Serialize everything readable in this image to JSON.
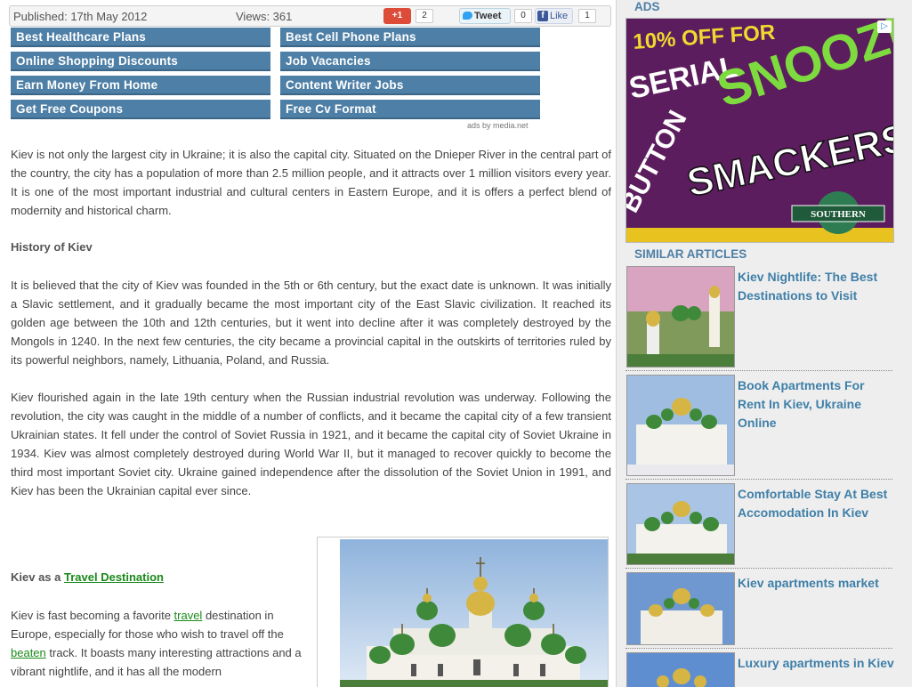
{
  "meta": {
    "published": "Published: 17th May 2012",
    "views": "Views: 361",
    "gplus_label": "+1",
    "gplus_count": "2",
    "tweet_label": "Tweet",
    "tweet_count": "0",
    "like_label": "Like",
    "like_count": "1"
  },
  "ad_links": [
    "Best Healthcare Plans",
    "Best Cell Phone Plans",
    "Online Shopping Discounts",
    "Job Vacancies",
    "Earn Money From Home",
    "Content Writer Jobs",
    "Get Free Coupons",
    "Free Cv Format"
  ],
  "ads_by": "ads by media.net",
  "article": {
    "intro": "Kiev is not only the largest city in Ukraine; it is also the capital city. Situated on the Dnieper River in the central part of the country, the city has a population of more than 2.5 million people, and it attracts over 1 million visitors every year. It is one of the most important industrial and cultural centers in Eastern Europe, and it is offers a perfect blend of modernity and historical charm.",
    "history_heading": "History of Kiev",
    "history_p1": "It is believed that the city of Kiev was founded in the 5th or 6th century, but the exact date is unknown. It was initially a Slavic settlement, and it gradually became the most important city of the East Slavic civilization. It reached its golden age between the 10th and 12th centuries, but it went into decline after it was completely destroyed by the Mongols in 1240. In the next few centuries, the city became a provincial capital in the outskirts of territories ruled by its powerful neighbors, namely, Lithuania, Poland, and Russia.",
    "history_p2": "Kiev flourished again in the late 19th century when the Russian industrial revolution was underway. Following the revolution, the city was caught in the middle of a number of conflicts, and it became the capital city of a few transient Ukrainian states. It fell under the control of Soviet Russia in 1921, and it became the capital city of Soviet Ukraine in 1934. Kiev was almost completely destroyed during World War II, but it managed to recover quickly to become the third most important Soviet city. Ukraine gained independence after the dissolution of the Soviet Union in 1991, and Kiev has been the Ukrainian capital ever since.",
    "travel_heading_prefix": "Kiev as a ",
    "travel_heading_link": "Travel Destination",
    "travel_p_1": "Kiev is fast becoming a favorite ",
    "travel_p_link1": "travel",
    "travel_p_2": " destination in Europe, especially for those who wish to travel off the ",
    "travel_p_link2": "beaten",
    "travel_p_3": " track. It boasts many interesting attractions and a vibrant nightlife, and it has all the modern"
  },
  "sidebar": {
    "ads_heading": "ADS",
    "ad_banner": {
      "line1": "10% OFF FOR",
      "line2": "SERIAL",
      "line3": "SNOOZE",
      "line4": "BUTTON",
      "line5": "SMACKERS",
      "brand": "SOUTHERN"
    },
    "similar_heading": "SIMILAR ARTICLES",
    "articles": [
      {
        "title": "Kiev Nightlife: The Best Destinations to Visit"
      },
      {
        "title": "Book Apartments For Rent In Kiev, Ukraine Online"
      },
      {
        "title": "Comfortable Stay At Best Accomodation In Kiev"
      },
      {
        "title": "Kiev apartments market"
      },
      {
        "title": "Luxury apartments in Kiev"
      }
    ]
  },
  "colors": {
    "ad_link_bg": "#4e7fa6",
    "link_green": "#1a8a1a",
    "sidebar_title": "#3f7fa8"
  }
}
